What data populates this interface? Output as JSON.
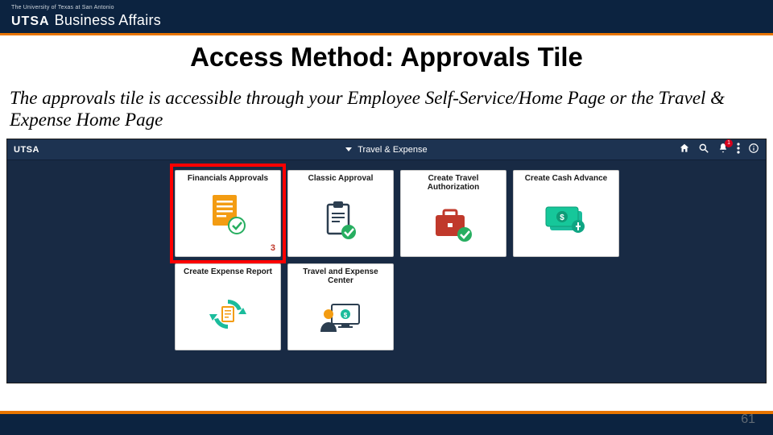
{
  "header": {
    "subtitle": "The University of Texas at San Antonio",
    "logo_utsa": "UTSA",
    "logo_ba": "Business Affairs"
  },
  "title": "Access Method: Approvals Tile",
  "body": "The approvals tile is accessible through your Employee Self-Service/Home Page or the Travel & Expense Home Page",
  "app": {
    "brand": "UTSA",
    "center_label": "Travel & Expense",
    "bell_count": "1",
    "tiles_top": [
      {
        "title": "Financials Approvals",
        "count": "3",
        "icon": "doc-check"
      },
      {
        "title": "Classic Approval",
        "icon": "clipboard-check"
      },
      {
        "title": "Create Travel Authorization",
        "icon": "briefcase-check"
      },
      {
        "title": "Create Cash Advance",
        "icon": "cash"
      }
    ],
    "tiles_bottom": [
      {
        "title": "Create Expense Report",
        "icon": "refresh-doc"
      },
      {
        "title": "Travel and Expense Center",
        "icon": "person-monitor"
      }
    ]
  },
  "page_number": "61",
  "colors": {
    "navy": "#0c2340",
    "orange": "#e87500",
    "red": "#ff0000"
  }
}
